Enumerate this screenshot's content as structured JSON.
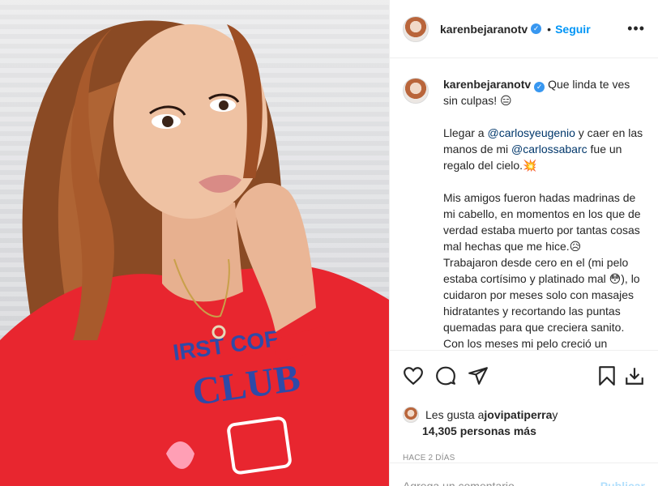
{
  "post": {
    "username": "karenbejaranotv",
    "dot": "•",
    "follow_label": "Seguir",
    "more_label": "•••"
  },
  "caption": {
    "username": "karenbejaranotv",
    "para1": "Que linda te ves sin culpas! 😑",
    "para2_a": "Llegar a ",
    "para2_mention1": "@carlosyeugenio",
    "para2_b": " y caer en las manos de mi ",
    "para2_mention2": "@carlossabarc",
    "para2_c": " fue un regalo del cielo.💥",
    "para3": "Mis amigos fueron hadas madrinas de mi cabello, en momentos en los que de verdad estaba muerto por tantas cosas mal hechas que me hice.😥",
    "para4": "Trabajaron desde cero en el (mi pelo estaba cortísimo y platinado mal 😳), lo cuidaron por meses solo con masajes hidratantes y recortando las puntas quemadas para que creciera sanito.",
    "para5": "Con los meses mi pelo creció un montón, agarro fuerza, le dieron vida y"
  },
  "likes": {
    "prefix": "Les gusta a ",
    "user": "jovipatiperra",
    "joiner": " y",
    "others": "14,305 personas más"
  },
  "time_ago": "HACE 2 DÍAS",
  "comment": {
    "placeholder": "Agrega un comentario...",
    "publish_label": "Publicar"
  },
  "colors": {
    "accent": "#0095f6",
    "publish_disabled": "#b2dffc",
    "verified": "#3897f0",
    "shirt": "#e8262f"
  },
  "icons": [
    "verified-badge-icon",
    "heart-icon",
    "comment-icon",
    "share-icon",
    "bookmark-icon",
    "download-icon"
  ]
}
